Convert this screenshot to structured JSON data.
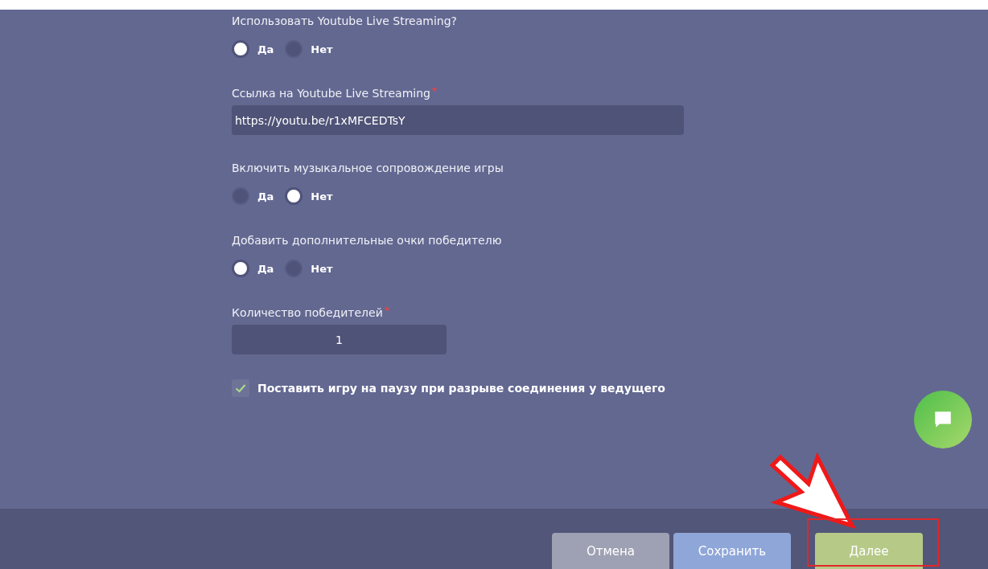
{
  "fields": [
    {
      "kind": "radio",
      "label": "Использовать Youtube Live Streaming?",
      "required": false,
      "options": [
        {
          "label": "Да",
          "selected": true
        },
        {
          "label": "Нет",
          "selected": false
        }
      ]
    },
    {
      "kind": "text",
      "label": "Ссылка на Youtube Live Streaming",
      "required": true,
      "value": "https://youtu.be/r1xMFCEDTsY"
    },
    {
      "kind": "radio",
      "label": "Включить музыкальное сопровождение игры",
      "required": false,
      "options": [
        {
          "label": "Да",
          "selected": false
        },
        {
          "label": "Нет",
          "selected": true
        }
      ]
    },
    {
      "kind": "radio",
      "label": "Добавить дополнительные очки победителю",
      "required": false,
      "options": [
        {
          "label": "Да",
          "selected": true
        },
        {
          "label": "Нет",
          "selected": false
        }
      ]
    },
    {
      "kind": "number",
      "label": "Количество победителей",
      "required": true,
      "value": "1"
    }
  ],
  "checkbox": {
    "label": "Поставить игру на паузу при разрыве соединения у ведущего",
    "checked": true
  },
  "buttons": [
    {
      "label": "Отмена",
      "kind": "cancel"
    },
    {
      "label": "Сохранить",
      "kind": "save"
    },
    {
      "label": "Далее",
      "kind": "next"
    }
  ]
}
